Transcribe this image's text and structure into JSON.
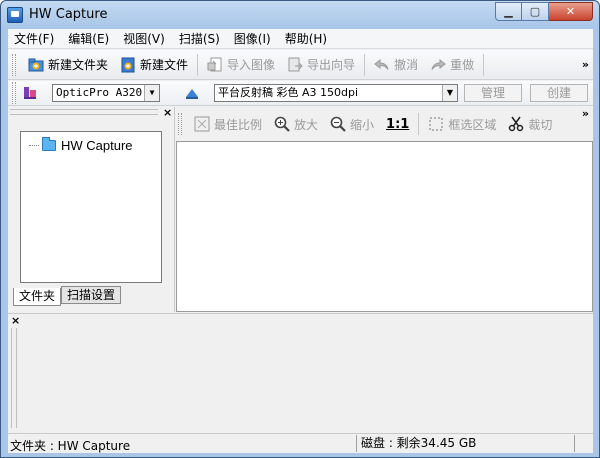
{
  "window": {
    "title": "HW Capture"
  },
  "menu": [
    "文件(F)",
    "编辑(E)",
    "视图(V)",
    "扫描(S)",
    "图像(I)",
    "帮助(H)"
  ],
  "toolbar": {
    "new_folder": "新建文件夹",
    "new_file": "新建文件",
    "import_image": "导入图像",
    "export_wizard": "导出向导",
    "undo": "撤消",
    "redo": "重做"
  },
  "scanner": {
    "device": "OpticPro A320",
    "profile": "平台反射稿 彩色 A3 150dpi",
    "manage": "管理",
    "create": "创建"
  },
  "tree": {
    "root": "HW Capture"
  },
  "left_tabs": [
    "文件夹",
    "扫描设置"
  ],
  "view_toolbar": {
    "best_fit": "最佳比例",
    "zoom_in": "放大",
    "zoom_out": "缩小",
    "actual_size": "1:1",
    "select_area": "框选区域",
    "crop": "裁切"
  },
  "status": {
    "folder": "文件夹 : HW Capture",
    "disk": "磁盘 : 剩余34.45 GB"
  }
}
